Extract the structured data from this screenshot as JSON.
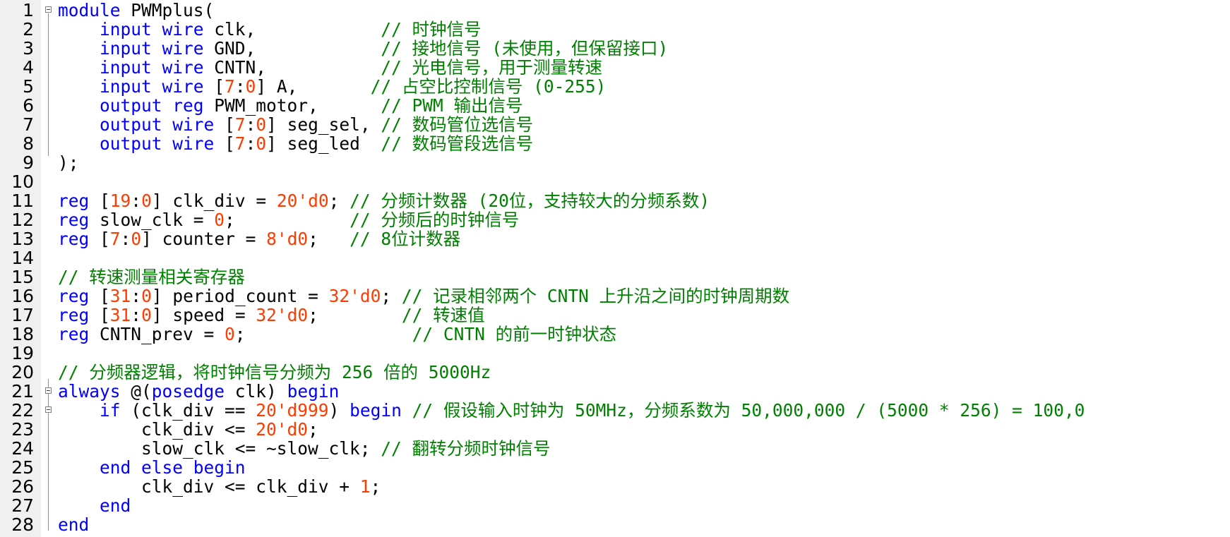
{
  "colors": {
    "keyword": "#0000ff",
    "number": "#ff3c00",
    "comment": "#008000",
    "text": "#000000",
    "gutter_bg": "#f0f0f0"
  },
  "lines": [
    {
      "n": "1",
      "fold": true,
      "tokens": [
        {
          "t": "kw",
          "v": "module"
        },
        {
          "t": "tx",
          "v": " PWMplus("
        }
      ]
    },
    {
      "n": "2",
      "tokens": [
        {
          "t": "tx",
          "v": "    "
        },
        {
          "t": "kw",
          "v": "input wire"
        },
        {
          "t": "tx",
          "v": " clk,            "
        },
        {
          "t": "cm",
          "v": "// 时钟信号"
        }
      ]
    },
    {
      "n": "3",
      "tokens": [
        {
          "t": "tx",
          "v": "    "
        },
        {
          "t": "kw",
          "v": "input wire"
        },
        {
          "t": "tx",
          "v": " GND,            "
        },
        {
          "t": "cm",
          "v": "// 接地信号 (未使用，但保留接口)"
        }
      ]
    },
    {
      "n": "4",
      "tokens": [
        {
          "t": "tx",
          "v": "    "
        },
        {
          "t": "kw",
          "v": "input wire"
        },
        {
          "t": "tx",
          "v": " CNTN,           "
        },
        {
          "t": "cm",
          "v": "// 光电信号，用于测量转速"
        }
      ]
    },
    {
      "n": "5",
      "tokens": [
        {
          "t": "tx",
          "v": "    "
        },
        {
          "t": "kw",
          "v": "input wire"
        },
        {
          "t": "tx",
          "v": " ["
        },
        {
          "t": "num",
          "v": "7"
        },
        {
          "t": "tx",
          "v": ":"
        },
        {
          "t": "num",
          "v": "0"
        },
        {
          "t": "tx",
          "v": "] A,       "
        },
        {
          "t": "cm",
          "v": "// 占空比控制信号 (0-255)"
        }
      ]
    },
    {
      "n": "6",
      "tokens": [
        {
          "t": "tx",
          "v": "    "
        },
        {
          "t": "kw",
          "v": "output reg"
        },
        {
          "t": "tx",
          "v": " PWM_motor,      "
        },
        {
          "t": "cm",
          "v": "// PWM 输出信号"
        }
      ]
    },
    {
      "n": "7",
      "tokens": [
        {
          "t": "tx",
          "v": "    "
        },
        {
          "t": "kw",
          "v": "output wire"
        },
        {
          "t": "tx",
          "v": " ["
        },
        {
          "t": "num",
          "v": "7"
        },
        {
          "t": "tx",
          "v": ":"
        },
        {
          "t": "num",
          "v": "0"
        },
        {
          "t": "tx",
          "v": "] seg_sel, "
        },
        {
          "t": "cm",
          "v": "// 数码管位选信号"
        }
      ]
    },
    {
      "n": "8",
      "tokens": [
        {
          "t": "tx",
          "v": "    "
        },
        {
          "t": "kw",
          "v": "output wire"
        },
        {
          "t": "tx",
          "v": " ["
        },
        {
          "t": "num",
          "v": "7"
        },
        {
          "t": "tx",
          "v": ":"
        },
        {
          "t": "num",
          "v": "0"
        },
        {
          "t": "tx",
          "v": "] seg_led  "
        },
        {
          "t": "cm",
          "v": "// 数码管段选信号"
        }
      ]
    },
    {
      "n": "9",
      "tokens": [
        {
          "t": "tx",
          "v": ");"
        }
      ]
    },
    {
      "n": "10",
      "tokens": []
    },
    {
      "n": "11",
      "tokens": [
        {
          "t": "kw",
          "v": "reg"
        },
        {
          "t": "tx",
          "v": " ["
        },
        {
          "t": "num",
          "v": "19"
        },
        {
          "t": "tx",
          "v": ":"
        },
        {
          "t": "num",
          "v": "0"
        },
        {
          "t": "tx",
          "v": "] clk_div = "
        },
        {
          "t": "num",
          "v": "20'd0"
        },
        {
          "t": "tx",
          "v": "; "
        },
        {
          "t": "cm",
          "v": "// 分频计数器 (20位，支持较大的分频系数)"
        }
      ]
    },
    {
      "n": "12",
      "tokens": [
        {
          "t": "kw",
          "v": "reg"
        },
        {
          "t": "tx",
          "v": " slow_clk = "
        },
        {
          "t": "num",
          "v": "0"
        },
        {
          "t": "tx",
          "v": ";           "
        },
        {
          "t": "cm",
          "v": "// 分频后的时钟信号"
        }
      ]
    },
    {
      "n": "13",
      "tokens": [
        {
          "t": "kw",
          "v": "reg"
        },
        {
          "t": "tx",
          "v": " ["
        },
        {
          "t": "num",
          "v": "7"
        },
        {
          "t": "tx",
          "v": ":"
        },
        {
          "t": "num",
          "v": "0"
        },
        {
          "t": "tx",
          "v": "] counter = "
        },
        {
          "t": "num",
          "v": "8'd0"
        },
        {
          "t": "tx",
          "v": ";   "
        },
        {
          "t": "cm",
          "v": "// 8位计数器"
        }
      ]
    },
    {
      "n": "14",
      "tokens": []
    },
    {
      "n": "15",
      "tokens": [
        {
          "t": "cm",
          "v": "// 转速测量相关寄存器"
        }
      ]
    },
    {
      "n": "16",
      "tokens": [
        {
          "t": "kw",
          "v": "reg"
        },
        {
          "t": "tx",
          "v": " ["
        },
        {
          "t": "num",
          "v": "31"
        },
        {
          "t": "tx",
          "v": ":"
        },
        {
          "t": "num",
          "v": "0"
        },
        {
          "t": "tx",
          "v": "] period_count = "
        },
        {
          "t": "num",
          "v": "32'd0"
        },
        {
          "t": "tx",
          "v": "; "
        },
        {
          "t": "cm",
          "v": "// 记录相邻两个 CNTN 上升沿之间的时钟周期数"
        }
      ]
    },
    {
      "n": "17",
      "tokens": [
        {
          "t": "kw",
          "v": "reg"
        },
        {
          "t": "tx",
          "v": " ["
        },
        {
          "t": "num",
          "v": "31"
        },
        {
          "t": "tx",
          "v": ":"
        },
        {
          "t": "num",
          "v": "0"
        },
        {
          "t": "tx",
          "v": "] speed = "
        },
        {
          "t": "num",
          "v": "32'd0"
        },
        {
          "t": "tx",
          "v": ";        "
        },
        {
          "t": "cm",
          "v": "// 转速值"
        }
      ]
    },
    {
      "n": "18",
      "tokens": [
        {
          "t": "kw",
          "v": "reg"
        },
        {
          "t": "tx",
          "v": " CNTN_prev = "
        },
        {
          "t": "num",
          "v": "0"
        },
        {
          "t": "tx",
          "v": ";                "
        },
        {
          "t": "cm",
          "v": "// CNTN 的前一时钟状态"
        }
      ]
    },
    {
      "n": "19",
      "tokens": []
    },
    {
      "n": "20",
      "tokens": [
        {
          "t": "cm",
          "v": "// 分频器逻辑，将时钟信号分频为 256 倍的 5000Hz"
        }
      ]
    },
    {
      "n": "21",
      "fold": true,
      "tokens": [
        {
          "t": "kw",
          "v": "always"
        },
        {
          "t": "tx",
          "v": " @("
        },
        {
          "t": "kw",
          "v": "posedge"
        },
        {
          "t": "tx",
          "v": " clk) "
        },
        {
          "t": "kw",
          "v": "begin"
        }
      ]
    },
    {
      "n": "22",
      "fold": true,
      "tokens": [
        {
          "t": "tx",
          "v": "    "
        },
        {
          "t": "kw",
          "v": "if"
        },
        {
          "t": "tx",
          "v": " (clk_div == "
        },
        {
          "t": "num",
          "v": "20'd999"
        },
        {
          "t": "tx",
          "v": ") "
        },
        {
          "t": "kw",
          "v": "begin"
        },
        {
          "t": "tx",
          "v": " "
        },
        {
          "t": "cm",
          "v": "// 假设输入时钟为 50MHz，分频系数为 50,000,000 / (5000 * 256) = 100,0"
        }
      ]
    },
    {
      "n": "23",
      "tokens": [
        {
          "t": "tx",
          "v": "        clk_div <= "
        },
        {
          "t": "num",
          "v": "20'd0"
        },
        {
          "t": "tx",
          "v": ";"
        }
      ]
    },
    {
      "n": "24",
      "tokens": [
        {
          "t": "tx",
          "v": "        slow_clk <= ~slow_clk; "
        },
        {
          "t": "cm",
          "v": "// 翻转分频时钟信号"
        }
      ]
    },
    {
      "n": "25",
      "tokens": [
        {
          "t": "tx",
          "v": "    "
        },
        {
          "t": "kw",
          "v": "end else begin"
        }
      ]
    },
    {
      "n": "26",
      "tokens": [
        {
          "t": "tx",
          "v": "        clk_div <= clk_div + "
        },
        {
          "t": "num",
          "v": "1"
        },
        {
          "t": "tx",
          "v": ";"
        }
      ]
    },
    {
      "n": "27",
      "tokens": [
        {
          "t": "tx",
          "v": "    "
        },
        {
          "t": "kw",
          "v": "end"
        }
      ]
    },
    {
      "n": "28",
      "tokens": [
        {
          "t": "kw",
          "v": "end"
        }
      ]
    }
  ]
}
